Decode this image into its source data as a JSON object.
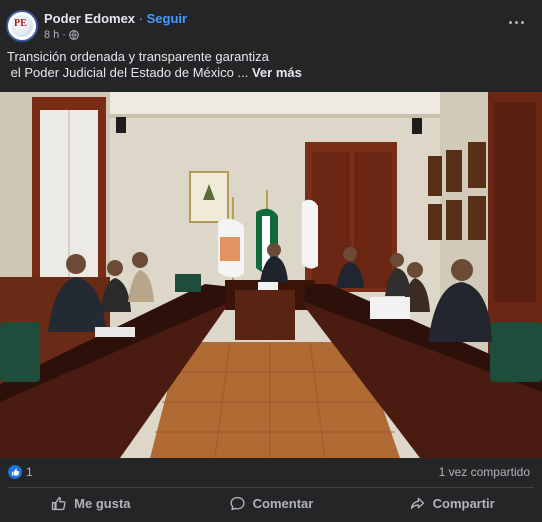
{
  "post": {
    "author": "Poder Edomex",
    "separator": "·",
    "follow_label": "Seguir",
    "time": "8 h",
    "time_separator": "·",
    "text_line1": "Transición ordenada y transparente garantiza",
    "text_line2": " el Poder Judicial del Estado de México",
    "ellipsis": " ... ",
    "see_more": "Ver más",
    "avatar_letters": "PE"
  },
  "stats": {
    "reaction_count": "1",
    "shares": "1 vez compartido"
  },
  "actions": {
    "like": "Me gusta",
    "comment": "Comentar",
    "share": "Compartir"
  },
  "colors": {
    "background": "#242526",
    "link": "#4599ff",
    "like_blue": "#1b74e4",
    "muted_text": "#b0b3b8"
  },
  "icons": [
    "globe-icon",
    "more-options-icon",
    "like-reaction-icon",
    "thumbs-up-icon",
    "comment-icon",
    "share-icon"
  ]
}
